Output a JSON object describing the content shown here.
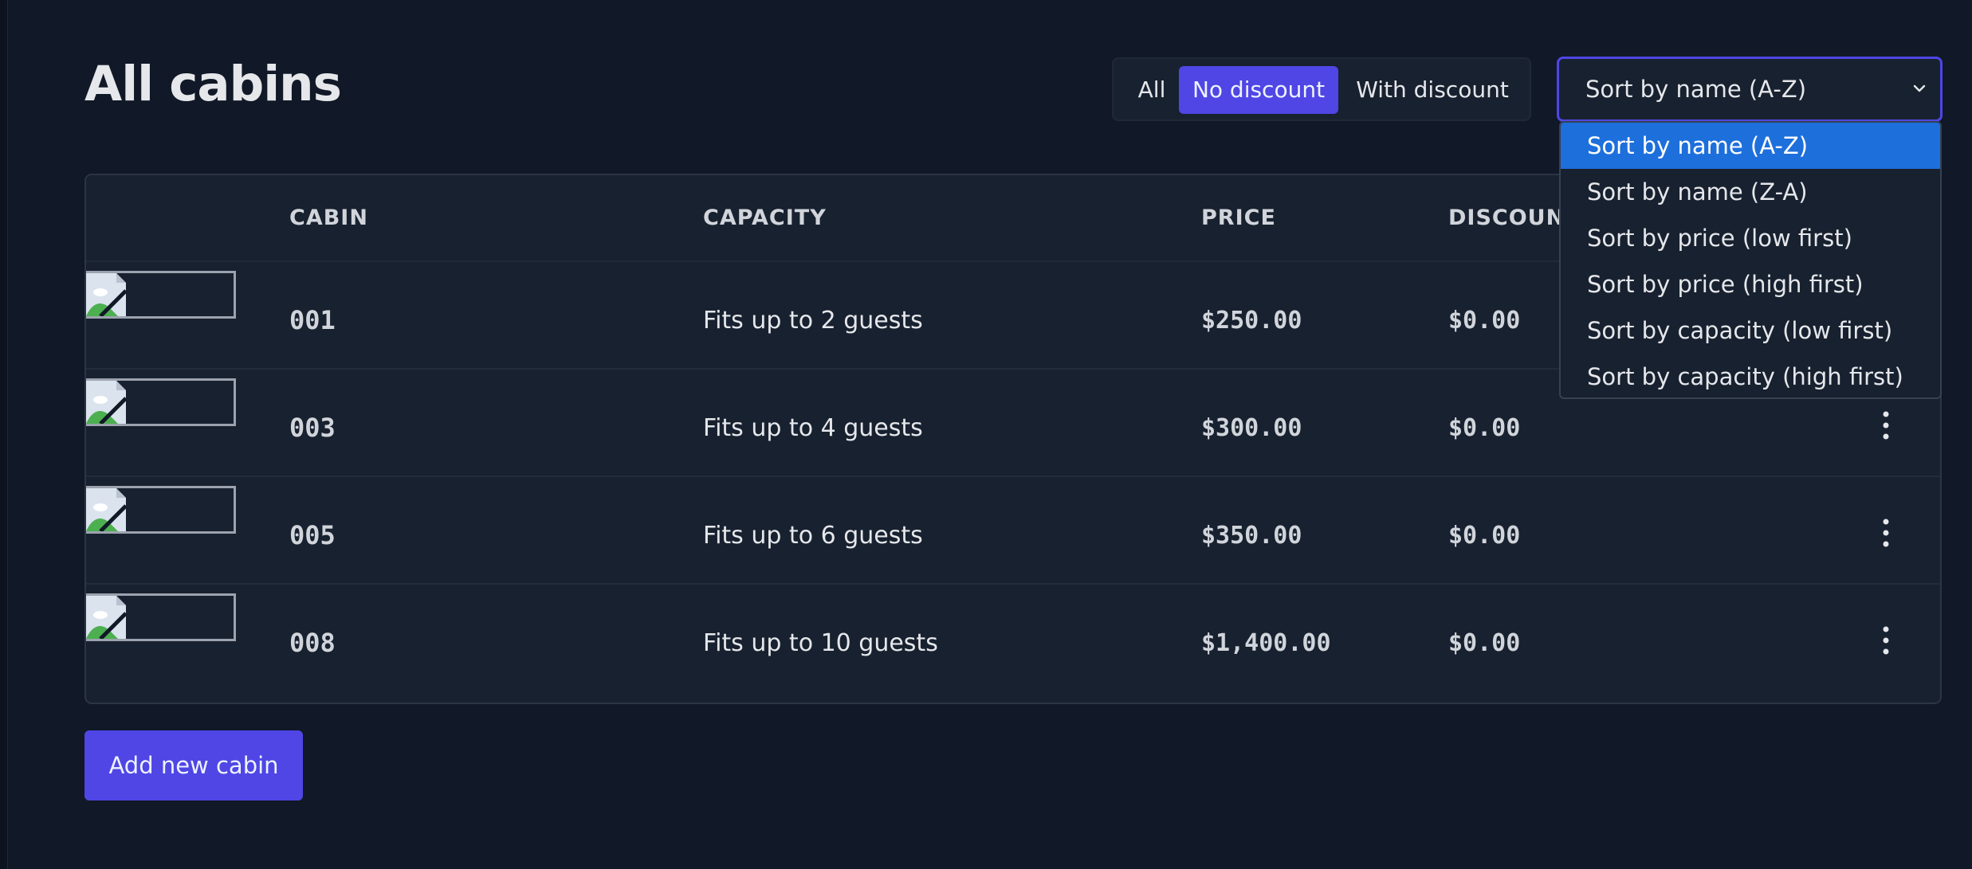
{
  "page": {
    "title": "All cabins"
  },
  "filter": {
    "options": [
      "All",
      "No discount",
      "With discount"
    ],
    "active": "No discount"
  },
  "sort": {
    "selected_label": "Sort by name (A-Z)",
    "options": [
      "Sort by name (A-Z)",
      "Sort by name (Z-A)",
      "Sort by price (low first)",
      "Sort by price (high first)",
      "Sort by capacity (low first)",
      "Sort by capacity (high first)"
    ],
    "selected_index": 0
  },
  "table": {
    "columns": [
      "",
      "CABIN",
      "CAPACITY",
      "PRICE",
      "DISCOUNT"
    ],
    "rows": [
      {
        "name": "001",
        "capacity": "Fits up to 2 guests",
        "price": "$250.00",
        "discount": "$0.00"
      },
      {
        "name": "003",
        "capacity": "Fits up to 4 guests",
        "price": "$300.00",
        "discount": "$0.00"
      },
      {
        "name": "005",
        "capacity": "Fits up to 6 guests",
        "price": "$350.00",
        "discount": "$0.00"
      },
      {
        "name": "008",
        "capacity": "Fits up to 10 guests",
        "price": "$1,400.00",
        "discount": "$0.00"
      }
    ]
  },
  "actions": {
    "add_label": "Add new cabin"
  },
  "colors": {
    "accent": "#4f46e5",
    "background": "#111827",
    "surface": "#18212f",
    "option_highlight": "#1d6fdc"
  },
  "icons": {
    "image_placeholder": "broken-image-icon",
    "row_menu": "more-vertical-icon",
    "select_arrow": "chevron-down-icon"
  }
}
